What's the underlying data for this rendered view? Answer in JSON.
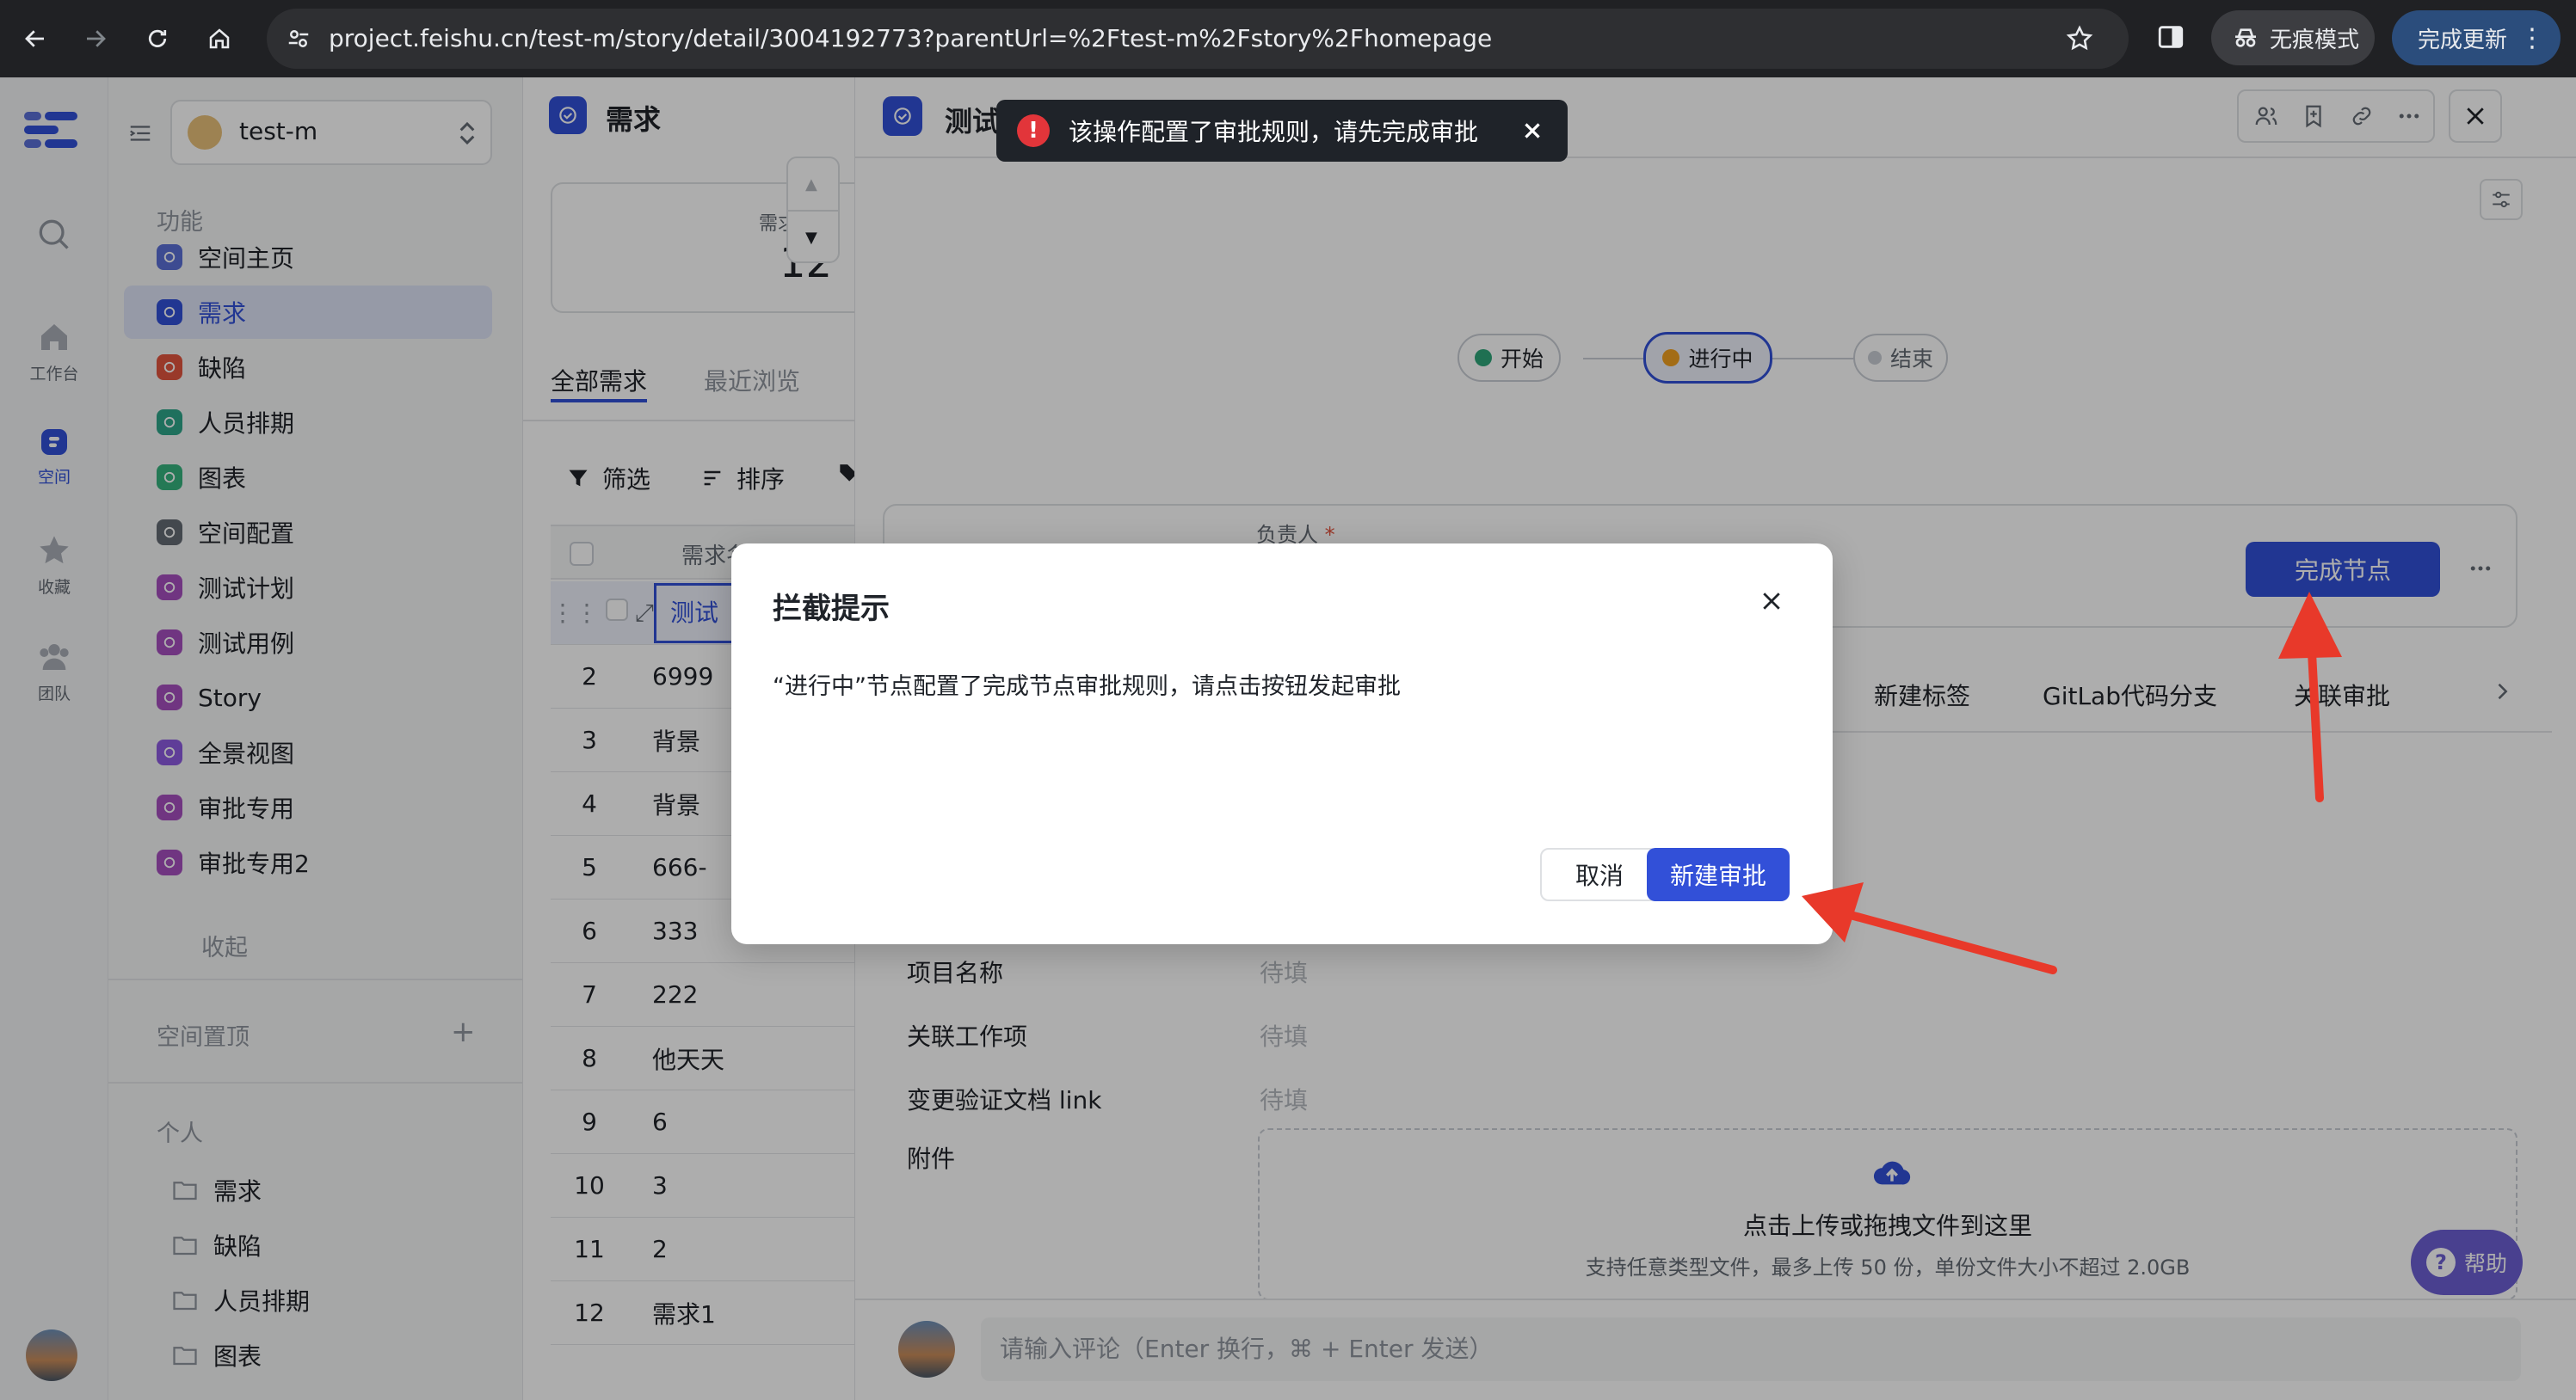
{
  "browser": {
    "url": "project.feishu.cn/test-m/story/detail/3004192773?parentUrl=%2Ftest-m%2Fstory%2Fhomepage",
    "incognito_label": "无痕模式",
    "update_label": "完成更新"
  },
  "rail": {
    "items": [
      {
        "label": "工作台",
        "icon": "home-icon"
      },
      {
        "label": "空间",
        "icon": "space-icon"
      },
      {
        "label": "收藏",
        "icon": "star-icon"
      },
      {
        "label": "团队",
        "icon": "team-icon"
      }
    ]
  },
  "sidebar": {
    "space_name": "test-m",
    "features_label": "功能",
    "items": [
      {
        "label": "空间主页",
        "color": "#5b6fd6"
      },
      {
        "label": "需求",
        "color": "#3250d8"
      },
      {
        "label": "缺陷",
        "color": "#e2553f"
      },
      {
        "label": "人员排期",
        "color": "#2ea58a"
      },
      {
        "label": "图表",
        "color": "#36b37e"
      },
      {
        "label": "空间配置",
        "color": "#646a73"
      },
      {
        "label": "测试计划",
        "color": "#a64fbf"
      },
      {
        "label": "测试用例",
        "color": "#a64fbf"
      },
      {
        "label": "Story",
        "color": "#a64fbf"
      },
      {
        "label": "全景视图",
        "color": "#8c5be0"
      },
      {
        "label": "审批专用",
        "color": "#a64fbf"
      },
      {
        "label": "审批专用2",
        "color": "#a64fbf"
      }
    ],
    "collapse_label": "收起",
    "pinned_label": "空间置顶",
    "personal_label": "个人",
    "personal_items": [
      "需求",
      "缺陷",
      "人员排期",
      "图表"
    ]
  },
  "list": {
    "title": "需求",
    "summary_label": "需求",
    "summary_count": "12",
    "tabs": [
      "全部需求",
      "最近浏览"
    ],
    "filter_label": "筛选",
    "sort_label": "排序",
    "column_header": "需求名称",
    "rows": [
      {
        "num": "",
        "name": "测试"
      },
      {
        "num": "2",
        "name": "6999"
      },
      {
        "num": "3",
        "name": "背景"
      },
      {
        "num": "4",
        "name": "背景"
      },
      {
        "num": "5",
        "name": "666-"
      },
      {
        "num": "6",
        "name": "333"
      },
      {
        "num": "7",
        "name": "222"
      },
      {
        "num": "8",
        "name": "他天天"
      },
      {
        "num": "9",
        "name": "6"
      },
      {
        "num": "10",
        "name": "3"
      },
      {
        "num": "11",
        "name": "2"
      },
      {
        "num": "12",
        "name": "需求1"
      }
    ]
  },
  "detail": {
    "title": "测试",
    "workflow": {
      "start": "开始",
      "in_progress": "进行中",
      "end": "结束"
    },
    "owner_label": "负责人",
    "complete_node_label": "完成节点",
    "link_tabs": [
      "新建标签",
      "GitLab代码分支",
      "关联审批"
    ],
    "fields": [
      {
        "label": "项目名称",
        "value": "待填"
      },
      {
        "label": "关联工作项",
        "value": "待填"
      },
      {
        "label": "变更验证文档 link",
        "value": "待填"
      }
    ],
    "attachment_label": "附件",
    "upload_title": "点击上传或拖拽文件到这里",
    "upload_hint": "支持任意类型文件，最多上传 50 份，单份文件大小不超过 2.0GB",
    "help_label": "帮助",
    "comment_placeholder": "请输入评论（Enter 换行，⌘ + Enter 发送）"
  },
  "toast": {
    "message": "该操作配置了审批规则，请先完成审批"
  },
  "dialog": {
    "title": "拦截提示",
    "body": "“进行中”节点配置了完成节点审批规则，请点击按钮发起审批",
    "cancel_label": "取消",
    "confirm_label": "新建审批"
  },
  "colors": {
    "accent": "#3250d8",
    "arrow": "#e8392a"
  }
}
